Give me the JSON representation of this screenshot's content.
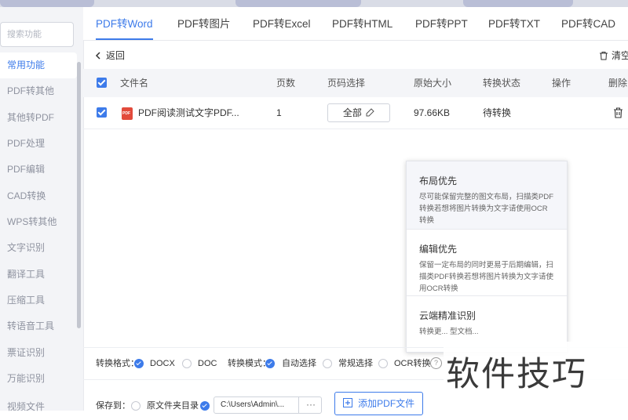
{
  "sidebar": {
    "search_placeholder": "搜索功能",
    "items": [
      "常用功能",
      "PDF转其他",
      "其他转PDF",
      "PDF处理",
      "PDF编辑",
      "CAD转换",
      "WPS转其他",
      "文字识别",
      "翻译工具",
      "压缩工具",
      "转语音工具",
      "票证识别",
      "万能识别",
      "视频文件"
    ]
  },
  "tabs": [
    "PDF转Word",
    "PDF转图片",
    "PDF转Excel",
    "PDF转HTML",
    "PDF转PPT",
    "PDF转TXT",
    "PDF转CAD"
  ],
  "toolbar": {
    "back_label": "返回",
    "clear_label": "清空"
  },
  "table": {
    "headers": {
      "name": "文件名",
      "pages": "页数",
      "page_select": "页码选择",
      "size": "原始大小",
      "status": "转换状态",
      "action": "操作",
      "delete": "删除"
    },
    "rows": [
      {
        "name": "PDF阅读测试文字PDF...",
        "pages": "1",
        "page_select": "全部",
        "size": "97.66KB",
        "status": "待转换"
      }
    ]
  },
  "dropdown": {
    "options": [
      {
        "title": "布局优先",
        "desc": "尽可能保留完整的图文布局，扫描类PDF转换若想将图片转换为文字请使用OCR转换"
      },
      {
        "title": "编辑优先",
        "desc": "保留一定布局的同时更易于后期编辑，扫描类PDF转换若想将图片转换为文字请使用OCR转换"
      },
      {
        "title": "云端精准识别",
        "desc": "转换更... 型文档..."
      }
    ]
  },
  "options_bar": {
    "format_label": "转换格式：",
    "format_options": [
      "DOCX",
      "DOC"
    ],
    "mode_label": "转换模式：",
    "mode_options": [
      "自动选择",
      "常规选择",
      "OCR转换"
    ]
  },
  "save_bar": {
    "save_label": "保存到：",
    "source_dir": "原文件夹目录",
    "path": "C:\\Users\\Admin\\...",
    "path_dots": "···",
    "add_button": "添加PDF文件"
  },
  "watermark": "软件技巧",
  "colors": {
    "accent": "#3d7bea",
    "pdf_red": "#e24a3b"
  }
}
